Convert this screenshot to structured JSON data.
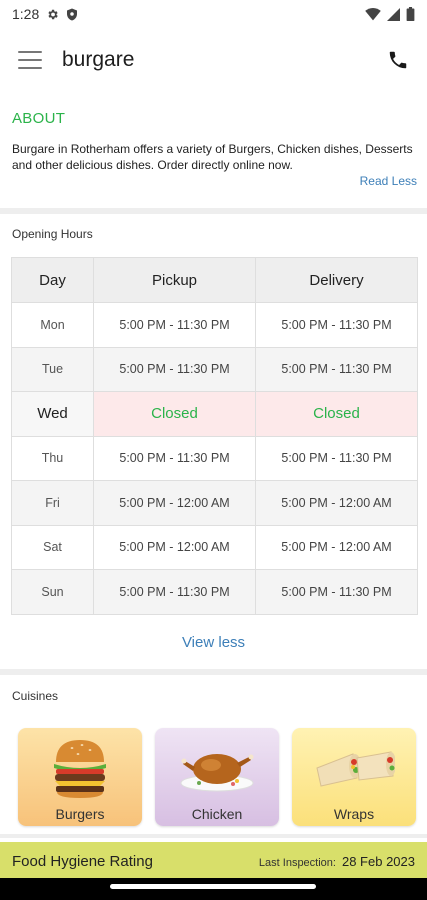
{
  "status": {
    "time": "1:28"
  },
  "appbar": {
    "title": "burgare"
  },
  "about": {
    "heading": "ABOUT",
    "text": "Burgare in Rotherham offers a variety of  Burgers, Chicken dishes, Desserts  and other delicious dishes. Order directly online now.",
    "read_less": "Read Less"
  },
  "opening": {
    "label": "Opening Hours",
    "headers": {
      "day": "Day",
      "pickup": "Pickup",
      "delivery": "Delivery"
    },
    "rows": [
      {
        "day": "Mon",
        "pickup": "5:00 PM - 11:30 PM",
        "delivery": "5:00 PM - 11:30 PM"
      },
      {
        "day": "Tue",
        "pickup": "5:00 PM - 11:30 PM",
        "delivery": "5:00 PM - 11:30 PM"
      },
      {
        "day": "Wed",
        "pickup": "Closed",
        "delivery": "Closed"
      },
      {
        "day": "Thu",
        "pickup": "5:00 PM - 11:30 PM",
        "delivery": "5:00 PM - 11:30 PM"
      },
      {
        "day": "Fri",
        "pickup": "5:00 PM - 12:00 AM",
        "delivery": "5:00 PM - 12:00 AM"
      },
      {
        "day": "Sat",
        "pickup": "5:00 PM - 12:00 AM",
        "delivery": "5:00 PM - 12:00 AM"
      },
      {
        "day": "Sun",
        "pickup": "5:00 PM - 11:30 PM",
        "delivery": "5:00 PM - 11:30 PM"
      }
    ],
    "view_less": "View less"
  },
  "cuisines": {
    "label": "Cuisines",
    "items": [
      {
        "name": "Burgers"
      },
      {
        "name": "Chicken"
      },
      {
        "name": "Wraps"
      }
    ]
  },
  "hygiene": {
    "title": "Food Hygiene Rating",
    "inspection_label": "Last Inspection:",
    "inspection_date": "28 Feb 2023"
  },
  "colors": {
    "accent_green": "#2bb34a",
    "link_blue": "#3d7fb8",
    "hygiene_bar": "#d8df6a",
    "closed_bg": "#fde9ea"
  }
}
